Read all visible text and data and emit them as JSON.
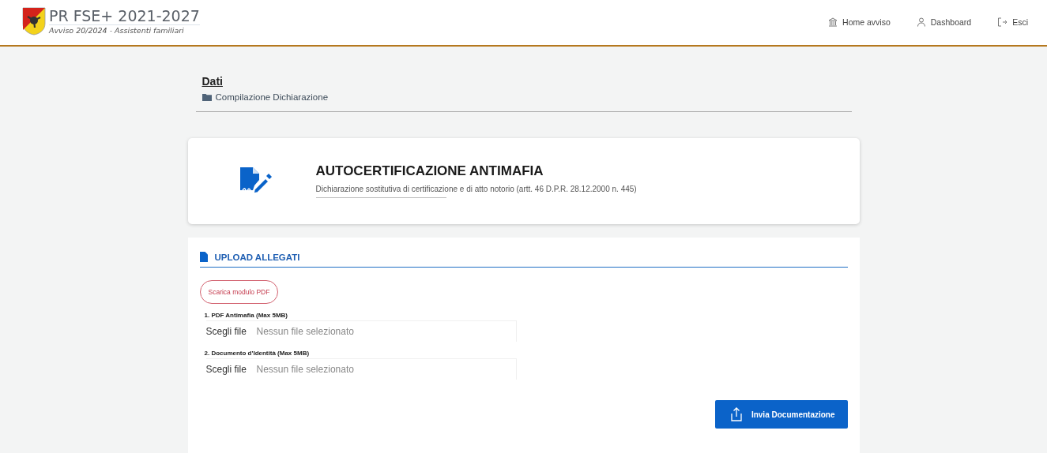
{
  "header": {
    "title": "PR FSE+ 2021-2027",
    "subtitle": "Avviso 20/2024 - Assistenti familiari",
    "nav": [
      {
        "kind": "home",
        "label": "Home avviso"
      },
      {
        "kind": "user",
        "label": "Dashboard"
      },
      {
        "kind": "exit",
        "label": "Esci"
      }
    ]
  },
  "page": {
    "title": "Dati",
    "breadcrumb": "Compilazione Dichiarazione"
  },
  "card": {
    "title": "AUTOCERTIFICAZIONE ANTIMAFIA",
    "subtitle": "Dichiarazione sostitutiva di certificazione e di atto notorio (artt. 46 D.P.R. 28.12.2000 n. 445)"
  },
  "upload": {
    "title": "UPLOAD ALLEGATI",
    "download_button": "Scarica modulo PDF",
    "files": [
      {
        "label": "1. PDF Antimafia (Max 5MB)",
        "button": "Scegli file",
        "value": "Nessun file selezionato"
      },
      {
        "label": "2. Documento d'Identità (Max 5MB)",
        "button": "Scegli file",
        "value": "Nessun file selezionato"
      }
    ],
    "submit": "Invia Documentazione"
  }
}
